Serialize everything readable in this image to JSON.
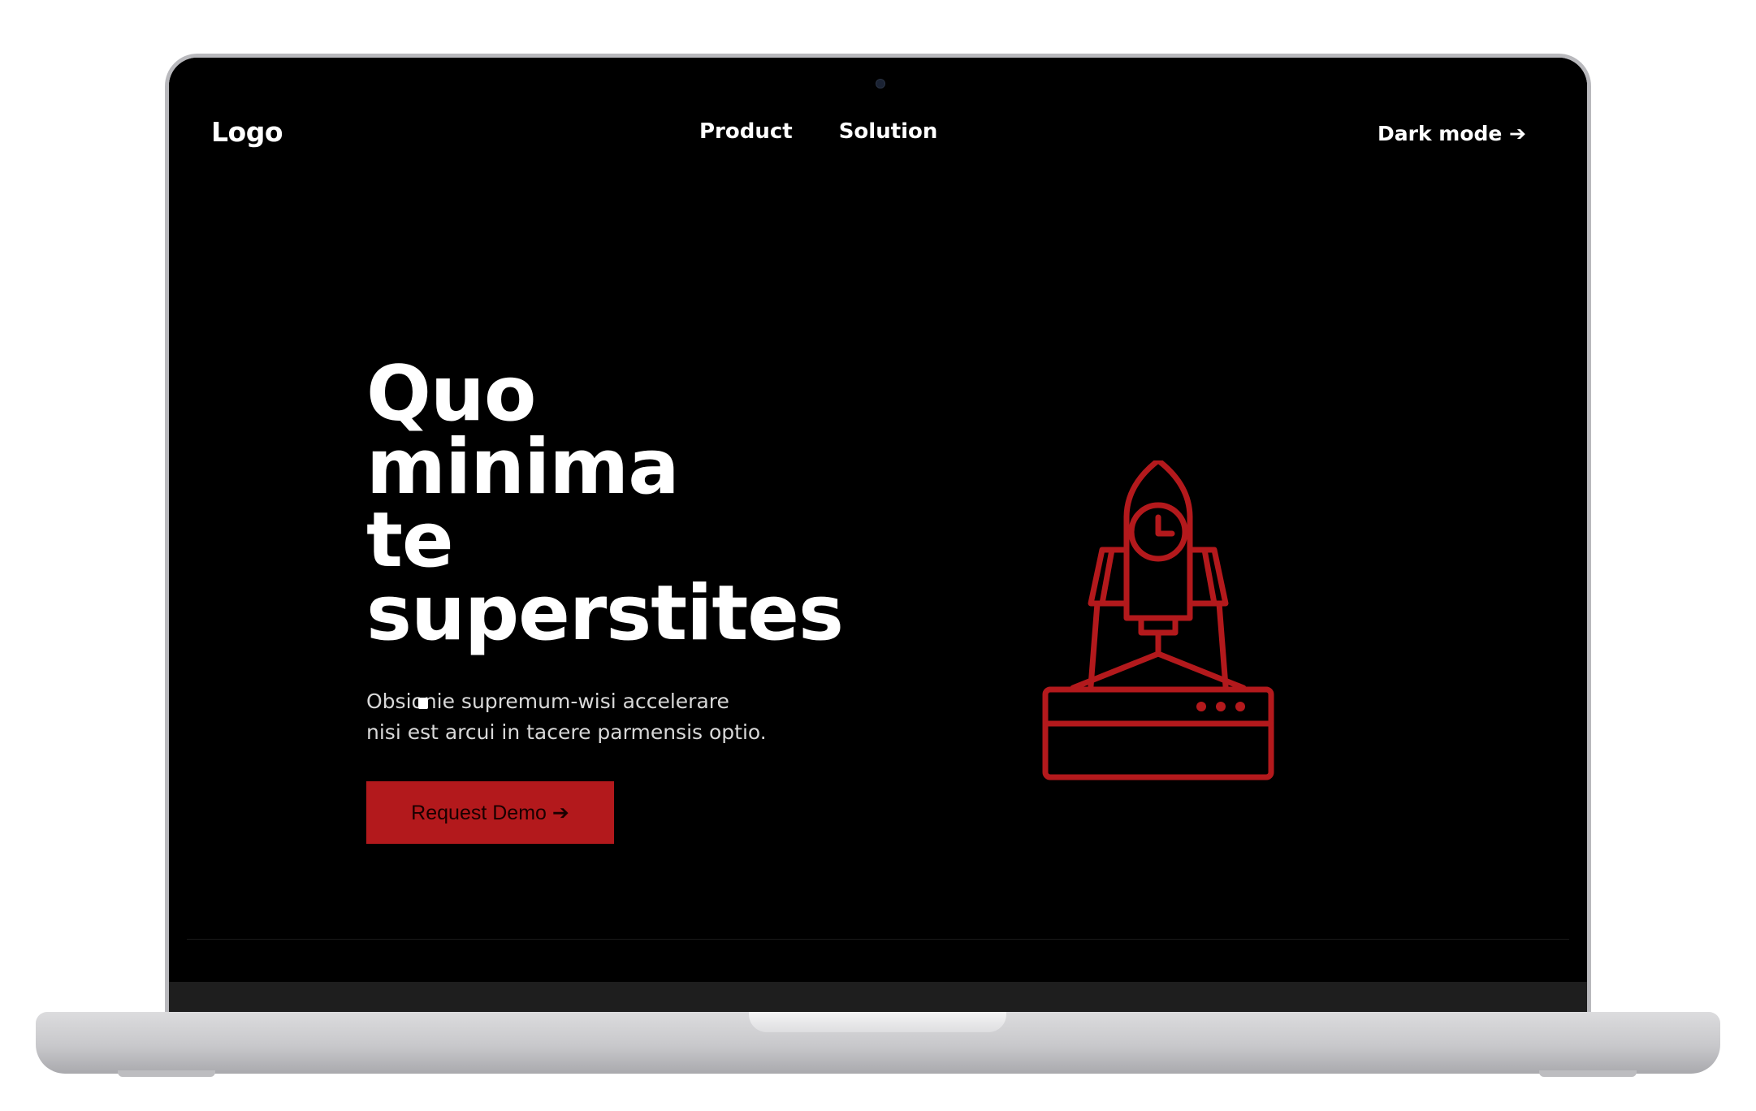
{
  "nav": {
    "logo": "Logo",
    "links": [
      "Product",
      "Solution"
    ],
    "dark_mode": "Dark mode ➔"
  },
  "hero": {
    "title_lines": [
      "Quo",
      "minima",
      "te",
      "superstites"
    ],
    "subtitle_lines": [
      "Obsionie supremum-wisi accelerare",
      "nisi est arcui in tacere parmensis optio."
    ],
    "cta_label": "Request Demo ➔"
  },
  "illustration": {
    "icon": "rocket-launch-icon",
    "color": "#b3191c"
  },
  "colors": {
    "background": "#000000",
    "accent": "#b3191c",
    "text": "#ffffff"
  }
}
